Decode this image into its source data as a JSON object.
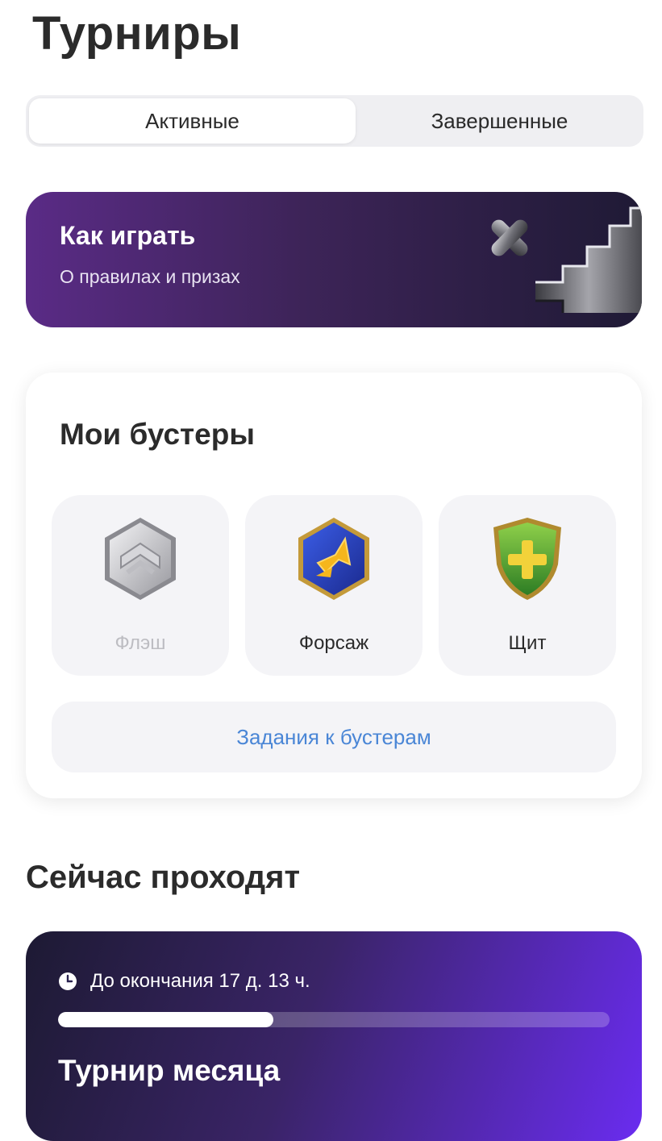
{
  "page": {
    "title": "Турниры"
  },
  "tabs": [
    {
      "label": "Активные",
      "selected": true
    },
    {
      "label": "Завершенные",
      "selected": false
    }
  ],
  "how_to_play": {
    "title": "Как играть",
    "subtitle": "О правилах и призах",
    "art_icons": [
      "cross-icon",
      "stairs-icon"
    ]
  },
  "boosters": {
    "title": "Мои бустеры",
    "items": [
      {
        "label": "Флэш",
        "icon": "flash-booster-icon",
        "enabled": false
      },
      {
        "label": "Форсаж",
        "icon": "boost-arrow-icon",
        "enabled": true
      },
      {
        "label": "Щит",
        "icon": "shield-icon",
        "enabled": true
      }
    ],
    "tasks_label": "Задания к бустерам"
  },
  "current": {
    "section_title": "Сейчас проходят",
    "tournament": {
      "time_left": "До окончания 17 д. 13 ч.",
      "progress_fraction": 0.39,
      "title": "Турнир месяца"
    }
  },
  "colors": {
    "link": "#4a86d6",
    "how_to_play_gradient": [
      "#5a2b86",
      "#1f1a35"
    ],
    "tournament_gradient": [
      "#1d1a33",
      "#6a2cf0"
    ]
  }
}
